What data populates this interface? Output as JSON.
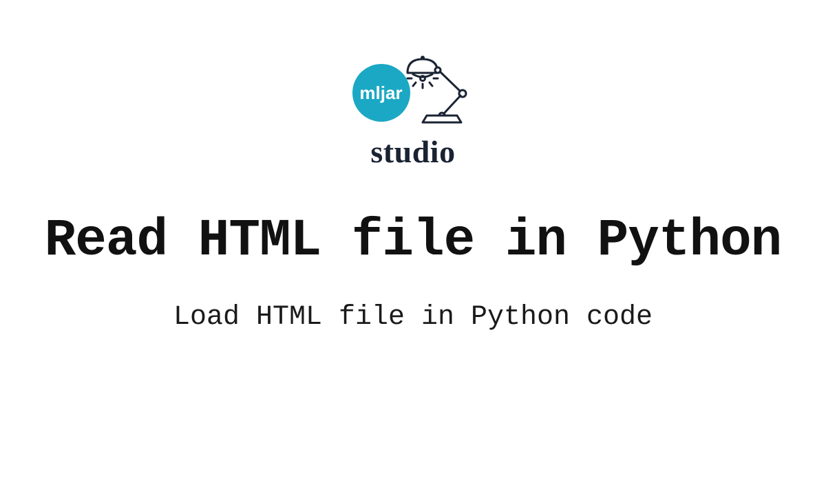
{
  "logo": {
    "badge_text": "mljar",
    "studio_text": "studio"
  },
  "headline": "Read HTML file in Python",
  "subtitle": "Load HTML file in Python code"
}
